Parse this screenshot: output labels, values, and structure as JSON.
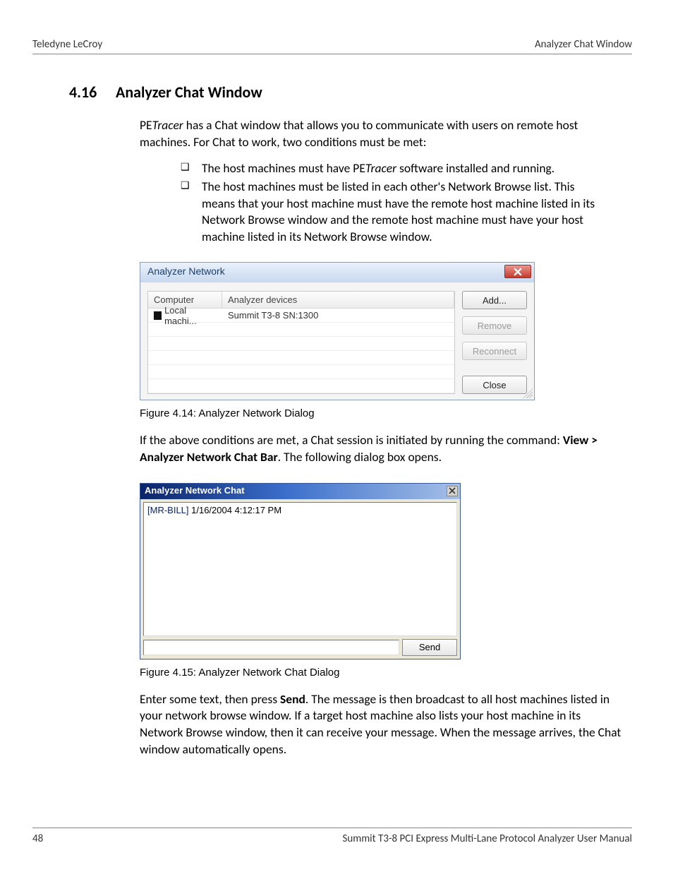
{
  "header": {
    "left": "Teledyne LeCroy",
    "right": "Analyzer Chat Window"
  },
  "section": {
    "number": "4.16",
    "title": "Analyzer Chat Window"
  },
  "intro": {
    "pre": "PE",
    "italic": "Tracer",
    "post": " has a Chat window that allows you to communicate with users on remote host machines. For Chat to work, two conditions must be met:"
  },
  "bullets": {
    "b1_pre": "The host machines must have PE",
    "b1_italic": "Tracer",
    "b1_post": " software installed and running.",
    "b2": "The host machines must be listed in each other's Network Browse list. This means that your host machine must have the remote host machine listed in its Network Browse window and the remote host machine must have your host machine listed in its Network Browse window."
  },
  "dlg_net": {
    "title": "Analyzer Network",
    "col_computer": "Computer",
    "col_devices": "Analyzer devices",
    "row1_computer": "Local machi...",
    "row1_devices": "Summit T3-8 SN:1300",
    "btn_add": "Add...",
    "btn_remove": "Remove",
    "btn_reconnect": "Reconnect",
    "btn_close": "Close"
  },
  "fig1_caption": "Figure 4.14:  Analyzer Network Dialog",
  "mid": {
    "line1": "If the above conditions are met, a Chat session is initiated by running the command: ",
    "bold": "View > Analyzer Network Chat Bar",
    "post": ". The following dialog box opens."
  },
  "dlg_chat": {
    "title": "Analyzer Network Chat",
    "log_user": "[MR-BILL]",
    "log_ts": " 1/16/2004 4:12:17 PM",
    "send": "Send"
  },
  "fig2_caption": "Figure 4.15:  Analyzer Network Chat Dialog",
  "closing": {
    "pre": "Enter some text, then press ",
    "bold": "Send",
    "post": ". The message is then broadcast to all host machines listed in your network browse window. If a target host machine also lists your host machine in its Network Browse window, then it can receive your message. When the message arrives, the Chat window automatically opens."
  },
  "footer": {
    "page": "48",
    "manual": "Summit T3-8 PCI Express Multi-Lane Protocol Analyzer User Manual"
  }
}
